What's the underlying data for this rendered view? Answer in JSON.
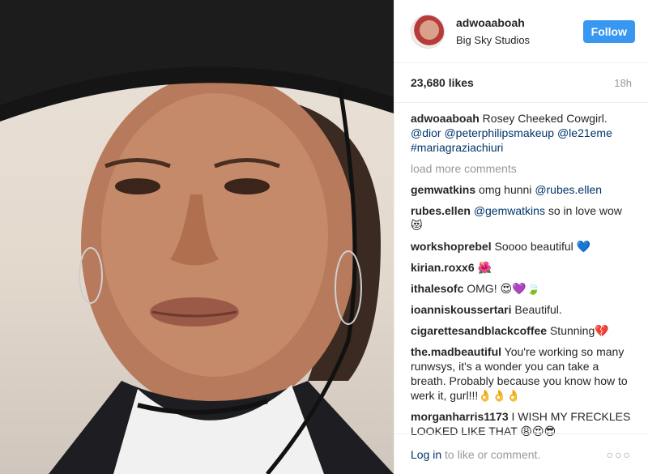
{
  "post": {
    "username": "adwoaaboah",
    "location": "Big Sky Studios",
    "follow_label": "Follow",
    "likes": "23,680 likes",
    "time": "18h",
    "caption_user": "adwoaaboah",
    "caption_text": " Rosey Cheeked Cowgirl. ",
    "caption_tags": "@dior @peterphilipsmakeup @le21eme #mariagraziachiuri",
    "load_more": "load more comments"
  },
  "comments": [
    {
      "user": "gemwatkins",
      "pre": " omg hunni ",
      "tag": "@rubes.ellen",
      "post": ""
    },
    {
      "user": "rubes.ellen",
      "pre": " ",
      "tag": "@gemwatkins",
      "post": " so in love wow 😻"
    },
    {
      "user": "workshoprebel",
      "pre": " Soooo beautiful 💙",
      "tag": "",
      "post": ""
    },
    {
      "user": "kirian.roxx6",
      "pre": " 🌺",
      "tag": "",
      "post": ""
    },
    {
      "user": "ithalesofc",
      "pre": " OMG! 😍💜🍃",
      "tag": "",
      "post": ""
    },
    {
      "user": "ioanniskoussertari",
      "pre": " Beautiful.",
      "tag": "",
      "post": ""
    },
    {
      "user": "cigarettesandblackcoffee",
      "pre": " Stunning💔",
      "tag": "",
      "post": ""
    },
    {
      "user": "the.madbeautiful",
      "pre": " You're working so many runwsys, it's a wonder you can take a breath. Probably because you know how to werk it, gurl!!!👌👌👌",
      "tag": "",
      "post": ""
    },
    {
      "user": "morganharris1173",
      "pre": " I WISH MY FRECKLES LOOKED LIKE THAT 😩😍😎",
      "tag": "",
      "post": ""
    }
  ],
  "footer": {
    "login": "Log in",
    "rest": " to like or comment.",
    "more_icon": "more-options-icon"
  },
  "colors": {
    "accent": "#3897f0",
    "link": "#003569",
    "muted": "#999999"
  }
}
